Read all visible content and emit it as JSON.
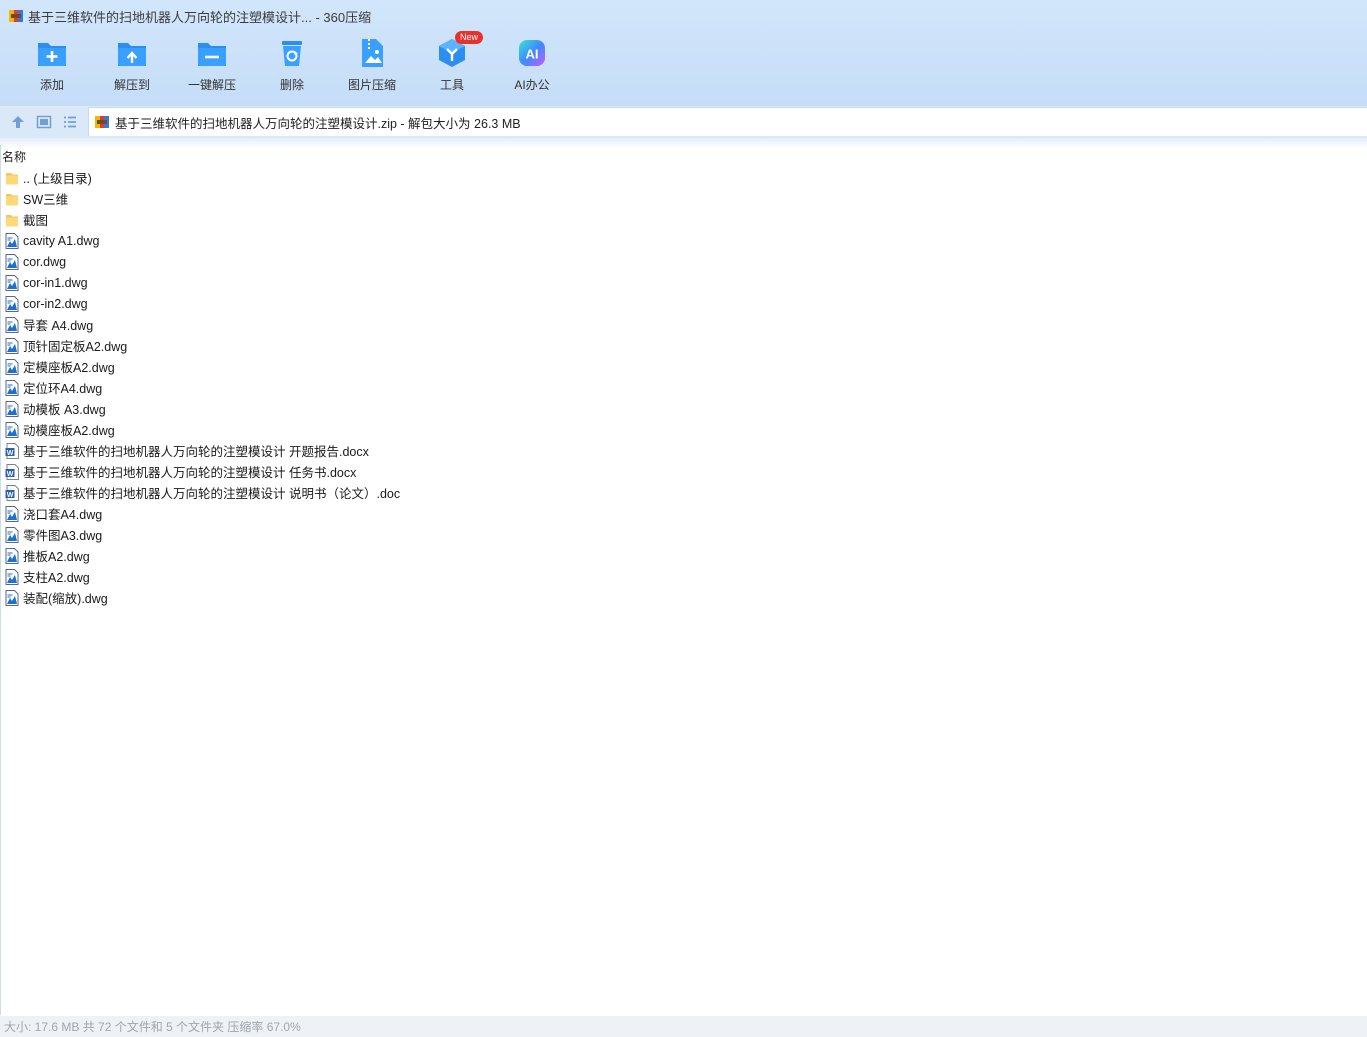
{
  "window": {
    "title": "基于三维软件的扫地机器人万向轮的注塑模设计... - 360压缩"
  },
  "toolbar": {
    "buttons": [
      {
        "label": "添加",
        "icon": "add-folder-icon"
      },
      {
        "label": "解压到",
        "icon": "extract-to-folder-icon"
      },
      {
        "label": "一键解压",
        "icon": "one-click-extract-icon"
      },
      {
        "label": "删除",
        "icon": "recycle-bin-icon"
      },
      {
        "label": "图片压缩",
        "icon": "image-compress-icon"
      },
      {
        "label": "工具",
        "icon": "tools-cube-icon",
        "badge": "New"
      },
      {
        "label": "AI办公",
        "icon": "ai-office-icon"
      }
    ]
  },
  "address": {
    "path": "基于三维软件的扫地机器人万向轮的注塑模设计.zip - 解包大小为 26.3 MB"
  },
  "list": {
    "header": "名称",
    "rows": [
      {
        "name": ".. (上级目录)",
        "type": "folder"
      },
      {
        "name": "SW三维",
        "type": "folder"
      },
      {
        "name": "截图",
        "type": "folder"
      },
      {
        "name": "cavity A1.dwg",
        "type": "dwg"
      },
      {
        "name": "cor.dwg",
        "type": "dwg"
      },
      {
        "name": "cor-in1.dwg",
        "type": "dwg"
      },
      {
        "name": "cor-in2.dwg",
        "type": "dwg"
      },
      {
        "name": "导套 A4.dwg",
        "type": "dwg"
      },
      {
        "name": "顶针固定板A2.dwg",
        "type": "dwg"
      },
      {
        "name": "定模座板A2.dwg",
        "type": "dwg"
      },
      {
        "name": "定位环A4.dwg",
        "type": "dwg"
      },
      {
        "name": "动模板 A3.dwg",
        "type": "dwg"
      },
      {
        "name": "动模座板A2.dwg",
        "type": "dwg"
      },
      {
        "name": "基于三维软件的扫地机器人万向轮的注塑模设计 开题报告.docx",
        "type": "word"
      },
      {
        "name": "基于三维软件的扫地机器人万向轮的注塑模设计 任务书.docx",
        "type": "word"
      },
      {
        "name": "基于三维软件的扫地机器人万向轮的注塑模设计 说明书（论文）.doc",
        "type": "word"
      },
      {
        "name": "浇口套A4.dwg",
        "type": "dwg"
      },
      {
        "name": "零件图A3.dwg",
        "type": "dwg"
      },
      {
        "name": "推板A2.dwg",
        "type": "dwg"
      },
      {
        "name": "支柱A2.dwg",
        "type": "dwg"
      },
      {
        "name": "装配(缩放).dwg",
        "type": "dwg"
      }
    ]
  },
  "status": {
    "text": "大小: 17.6 MB 共 72 个文件和 5 个文件夹 压缩率 67.0%"
  }
}
